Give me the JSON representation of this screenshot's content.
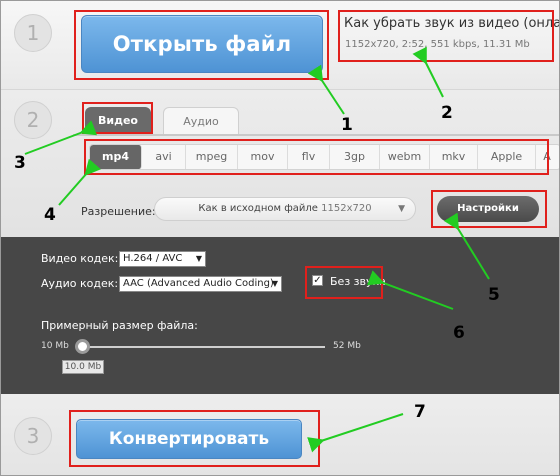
{
  "steps": {
    "one": "1",
    "two": "2",
    "three": "3"
  },
  "open_button_label": "Открыть файл",
  "file": {
    "title": "Как убрать звук из видео (онлайн) (",
    "meta": "1152x720, 2:52, 551 kbps, 11.31 Mb"
  },
  "tabs": [
    {
      "label": "Видео",
      "active": true
    },
    {
      "label": "Аудио",
      "active": false
    }
  ],
  "formats": [
    "mp4",
    "avi",
    "mpeg",
    "mov",
    "flv",
    "3gp",
    "webm",
    "mkv",
    "Apple",
    "A"
  ],
  "active_format": "mp4",
  "resolution": {
    "label": "Разрешение:",
    "value": "Как в исходном файле",
    "dims": "1152x720"
  },
  "settings_button_label": "Настройки",
  "video_codec": {
    "label": "Видео кодек:",
    "value": "H.264 / AVC"
  },
  "audio_codec": {
    "label": "Аудио кодек:",
    "value": "AAC (Advanced Audio Coding)"
  },
  "mute": {
    "label": "Без звука",
    "checked": true
  },
  "file_size": {
    "label": "Примерный размер файла:",
    "min": "10 Mb",
    "max": "52 Mb",
    "current": "10.0 Mb",
    "fraction": 0.0
  },
  "convert_button_label": "Конвертировать",
  "annotations": [
    "1",
    "2",
    "3",
    "4",
    "5",
    "6",
    "7"
  ],
  "colors": {
    "accent_button": "#5aa0df",
    "annotation_red": "#e0201c",
    "annotation_arrow": "#22cc22",
    "panel_dark": "#474747"
  }
}
